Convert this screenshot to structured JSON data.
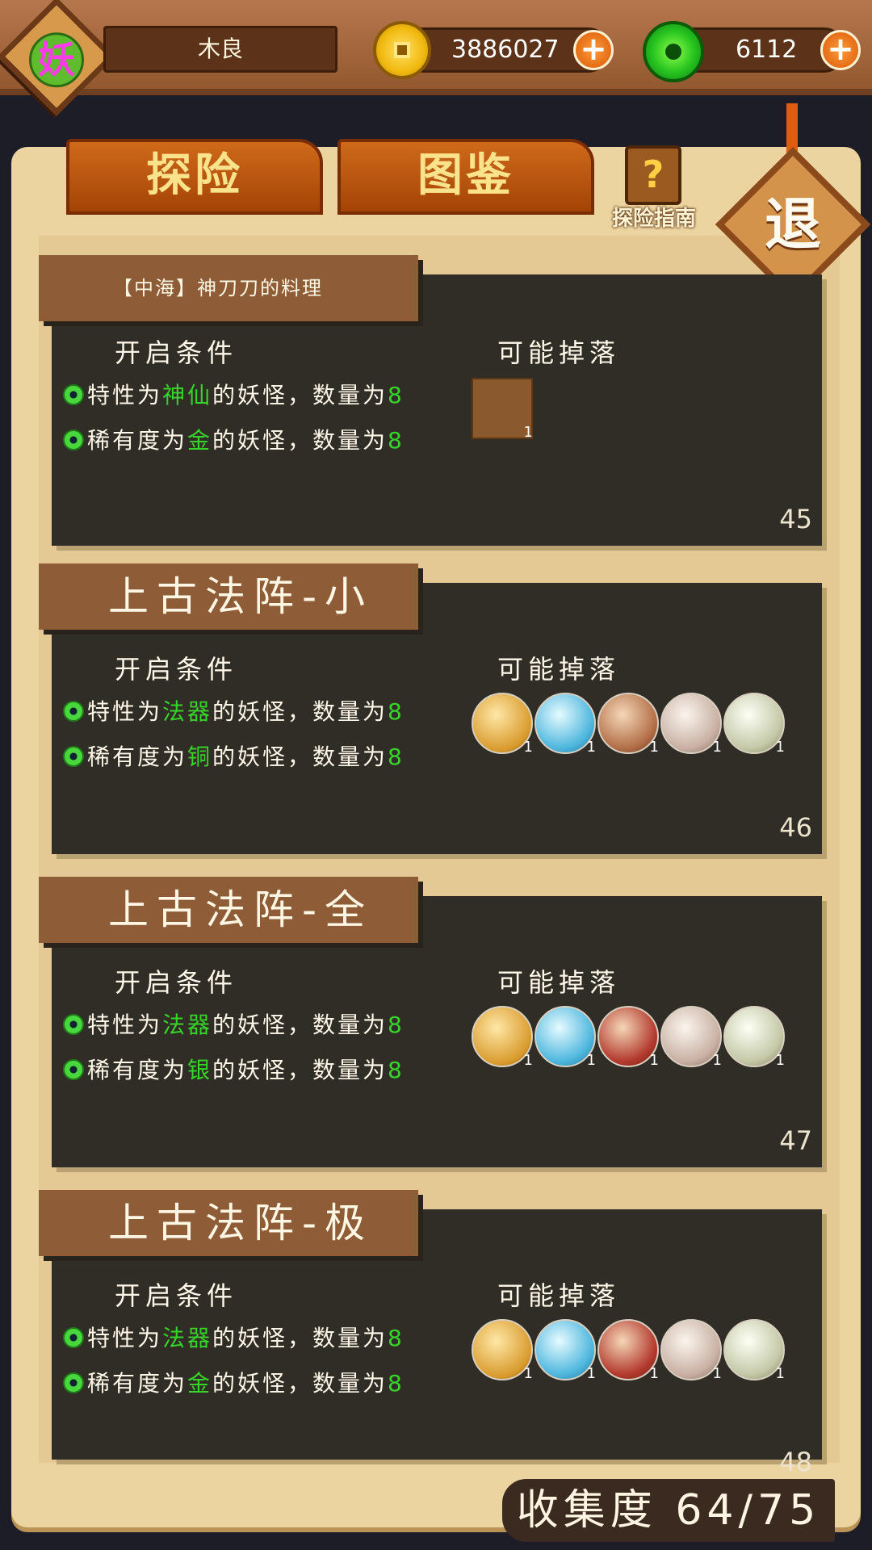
{
  "header": {
    "avatar_char": "妖",
    "player_name": "木良",
    "coins": "3886027",
    "jade": "6112",
    "plus": "+"
  },
  "tabs": [
    {
      "label": "探险"
    },
    {
      "label": "图鉴"
    }
  ],
  "guide": {
    "label": "探险指南",
    "icon_char": "?"
  },
  "exit": {
    "label": "退"
  },
  "labels": {
    "conditions": "开启条件",
    "drops": "可能掉落"
  },
  "cards": [
    {
      "title": "【中海】神刀刀的料理",
      "cond1": {
        "pre": "特性为",
        "hl": "神仙",
        "post": "的妖怪，数量为",
        "num": "8"
      },
      "cond2": {
        "pre": "稀有度为",
        "hl": "金",
        "post": "的妖怪，数量为",
        "num": "8"
      },
      "drops": [
        {
          "icon": "food-box-icon",
          "count": "1"
        }
      ],
      "number": "45"
    },
    {
      "title": "上古法阵-小",
      "cond1": {
        "pre": "特性为",
        "hl": "法器",
        "post": "的妖怪，数量为",
        "num": "8"
      },
      "cond2": {
        "pre": "稀有度为",
        "hl": "铜",
        "post": "的妖怪，数量为",
        "num": "8"
      },
      "drops": [
        {
          "icon": "gold-token-icon",
          "count": "1",
          "glyph": "庄"
        },
        {
          "icon": "blue-chip-icon",
          "count": "1"
        },
        {
          "icon": "money-bag-icon",
          "count": "1"
        },
        {
          "icon": "card-icon",
          "count": "1",
          "glyph": "㐅"
        },
        {
          "icon": "dice-icon",
          "count": "1"
        }
      ],
      "number": "46"
    },
    {
      "title": "上古法阵-全",
      "cond1": {
        "pre": "特性为",
        "hl": "法器",
        "post": "的妖怪，数量为",
        "num": "8"
      },
      "cond2": {
        "pre": "稀有度为",
        "hl": "银",
        "post": "的妖怪，数量为",
        "num": "8"
      },
      "drops": [
        {
          "icon": "gold-token-icon",
          "count": "1",
          "glyph": "庄"
        },
        {
          "icon": "blue-chip-icon",
          "count": "1"
        },
        {
          "icon": "red-bag-icon",
          "count": "1"
        },
        {
          "icon": "card-icon",
          "count": "1",
          "glyph": "㐅"
        },
        {
          "icon": "dice-icon",
          "count": "1"
        }
      ],
      "number": "47"
    },
    {
      "title": "上古法阵-极",
      "cond1": {
        "pre": "特性为",
        "hl": "法器",
        "post": "的妖怪，数量为",
        "num": "8"
      },
      "cond2": {
        "pre": "稀有度为",
        "hl": "金",
        "post": "的妖怪，数量为",
        "num": "8"
      },
      "drops": [
        {
          "icon": "gold-token-icon",
          "count": "1",
          "glyph": "庄"
        },
        {
          "icon": "blue-chip-icon",
          "count": "1"
        },
        {
          "icon": "red-bag-icon",
          "count": "1"
        },
        {
          "icon": "card-icon",
          "count": "1",
          "glyph": "㐅"
        },
        {
          "icon": "dice-icon",
          "count": "1"
        }
      ],
      "number": "48"
    }
  ],
  "collection": {
    "label": "收集度",
    "value": "64/75"
  },
  "colors": {
    "highlight": "#37d42a",
    "tab": "#c15812",
    "panel": "#302d26"
  }
}
